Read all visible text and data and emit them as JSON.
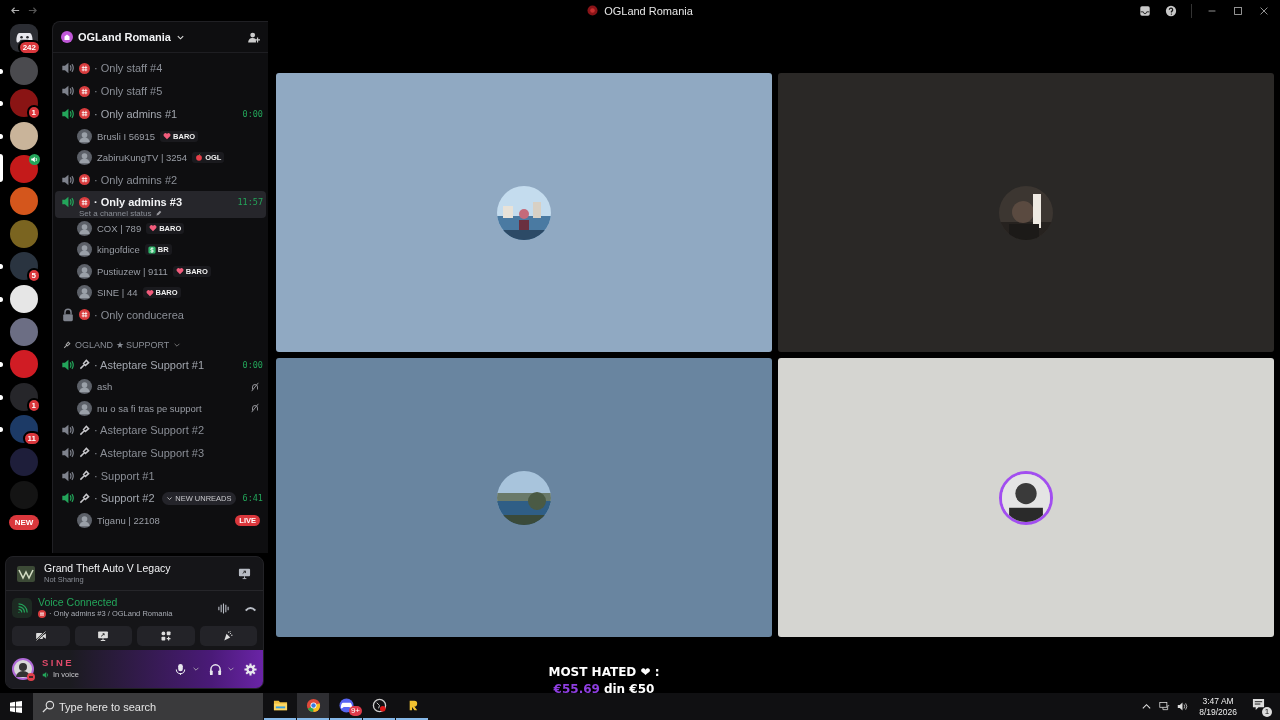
{
  "window": {
    "title": "OGLand Romania"
  },
  "servers": [
    {
      "kind": "home",
      "badge": "242",
      "unread": false,
      "selected": false,
      "voice": false
    },
    {
      "kind": "server",
      "color": "#4a4a4e",
      "unread": true,
      "selected": false,
      "voice": false
    },
    {
      "kind": "server",
      "color": "#8a1414",
      "badge": "1",
      "unread": true,
      "selected": false,
      "voice": false
    },
    {
      "kind": "server",
      "color": "#c9b49a",
      "unread": true,
      "selected": false,
      "voice": false
    },
    {
      "kind": "server",
      "color": "#c41a1a",
      "unread": false,
      "selected": true,
      "voice": true
    },
    {
      "kind": "server",
      "color": "#d4561c",
      "unread": false,
      "selected": false,
      "voice": false
    },
    {
      "kind": "server",
      "color": "#7a6420",
      "unread": false,
      "selected": false,
      "voice": false
    },
    {
      "kind": "server",
      "color": "#2a3440",
      "badge": "5",
      "unread": true,
      "selected": false,
      "voice": false
    },
    {
      "kind": "server",
      "color": "#e6e6e6",
      "unread": true,
      "selected": false,
      "voice": false
    },
    {
      "kind": "server",
      "color": "#6c6e84",
      "unread": false,
      "selected": false,
      "voice": false
    },
    {
      "kind": "server",
      "color": "#d01c24",
      "unread": true,
      "selected": false,
      "voice": false
    },
    {
      "kind": "server",
      "color": "#26262a",
      "badge": "1",
      "unread": true,
      "selected": false,
      "voice": false
    },
    {
      "kind": "server",
      "color": "#1c3a66",
      "badge": "11",
      "unread": true,
      "selected": false,
      "voice": false
    },
    {
      "kind": "server",
      "color": "#1e1e3a",
      "unread": false,
      "selected": false,
      "voice": false
    },
    {
      "kind": "server",
      "color": "#141414",
      "unread": false,
      "selected": false,
      "voice": false
    }
  ],
  "new_pill": "NEW",
  "server": {
    "name": "OGLand Romania"
  },
  "sections": [
    {
      "channels": [
        {
          "kind": "voice",
          "emblem": {
            "kind": "emoji"
          },
          "name": "· Only staff #4",
          "active": false,
          "selected": false
        },
        {
          "kind": "voice",
          "emblem": {
            "kind": "emoji"
          },
          "name": "· Only staff #5",
          "active": false,
          "selected": false
        },
        {
          "kind": "voice",
          "emblem": {
            "kind": "emoji"
          },
          "name": "· Only admins #1",
          "active": true,
          "selected": false,
          "timer": "0:00",
          "members": [
            {
              "name": "Brusli I 56915",
              "tag": {
                "kind": "heart",
                "label": "BARO"
              },
              "muted": false
            },
            {
              "name": "ZabiruKungTV | 3254",
              "tag": {
                "kind": "apple",
                "label": "OGL"
              },
              "muted": false
            }
          ]
        },
        {
          "kind": "voice",
          "emblem": {
            "kind": "emoji"
          },
          "name": "· Only admins #2",
          "active": false,
          "selected": false
        },
        {
          "kind": "voice",
          "emblem": {
            "kind": "emoji"
          },
          "name": "· Only admins #3",
          "active": true,
          "selected": true,
          "timer": "11:57",
          "status": "Set a channel status",
          "members": [
            {
              "name": "COX | 789",
              "tag": {
                "kind": "heart",
                "label": "BARO"
              },
              "muted": false
            },
            {
              "name": "kingofdice",
              "tag": {
                "kind": "dollar",
                "label": "BR"
              },
              "muted": false
            },
            {
              "name": "Pustiuzew | 9111",
              "tag": {
                "kind": "heart",
                "label": "BARO"
              },
              "muted": false
            },
            {
              "name": "SINE | 44",
              "tag": {
                "kind": "heart",
                "label": "BARO"
              },
              "muted": false
            }
          ]
        },
        {
          "kind": "locked",
          "emblem": {
            "kind": "emoji"
          },
          "name": "· Only conducerea",
          "active": false,
          "selected": false
        }
      ]
    },
    {
      "title": "OGLAND ★ SUPPORT",
      "channels": [
        {
          "kind": "voice",
          "emblem": {
            "kind": "mic"
          },
          "name": "· Asteptare Support #1",
          "active": true,
          "selected": false,
          "timer": "0:00",
          "members": [
            {
              "name": "ash",
              "muted": true
            },
            {
              "name": "nu o sa fi tras pe support",
              "muted": true
            }
          ]
        },
        {
          "kind": "voice",
          "emblem": {
            "kind": "mic"
          },
          "name": "· Asteptare Support #2",
          "active": false,
          "selected": false
        },
        {
          "kind": "voice",
          "emblem": {
            "kind": "mic"
          },
          "name": "· Asteptare Support #3",
          "active": false,
          "selected": false
        },
        {
          "kind": "voice",
          "emblem": {
            "kind": "mic"
          },
          "name": "· Support #1",
          "active": false,
          "selected": false
        },
        {
          "kind": "voice",
          "emblem": {
            "kind": "mic"
          },
          "name": "· Support #2",
          "active": true,
          "selected": false,
          "timer": "6:41",
          "members": [
            {
              "name": "Tiganu | 22108",
              "muted": false,
              "live": "LIVE"
            }
          ]
        }
      ]
    }
  ],
  "unreads_pill": "NEW UNREADS",
  "activity": {
    "title": "Grand Theft Auto V Legacy",
    "status": "Not Sharing"
  },
  "voice": {
    "status": "Voice Connected",
    "channel": "· Only admins #3 / OGLand Romania"
  },
  "user": {
    "name": "SINE",
    "status": "In voice"
  },
  "tiles": [
    {
      "color": "#90a9c2",
      "speaking": false
    },
    {
      "color": "#2a2826",
      "speaking": false
    },
    {
      "color": "#6985a0",
      "speaking": false
    },
    {
      "color": "#d5d5d1",
      "speaking": true
    }
  ],
  "overlay": {
    "title": "MOST HATED ❤ :",
    "amount": "€55.69",
    "rest": "din €50"
  },
  "taskbar": {
    "search": {
      "placeholder": "Type here to search"
    },
    "apps": [
      {
        "kind": "folder",
        "active": false
      },
      {
        "kind": "chrome",
        "active": true
      },
      {
        "kind": "discord",
        "badge": "9+",
        "active": false
      },
      {
        "kind": "recorder",
        "active": false
      },
      {
        "kind": "letter",
        "active": false
      }
    ],
    "time": "3:47 AM",
    "date": "8/19/2026",
    "notifications": "1"
  }
}
